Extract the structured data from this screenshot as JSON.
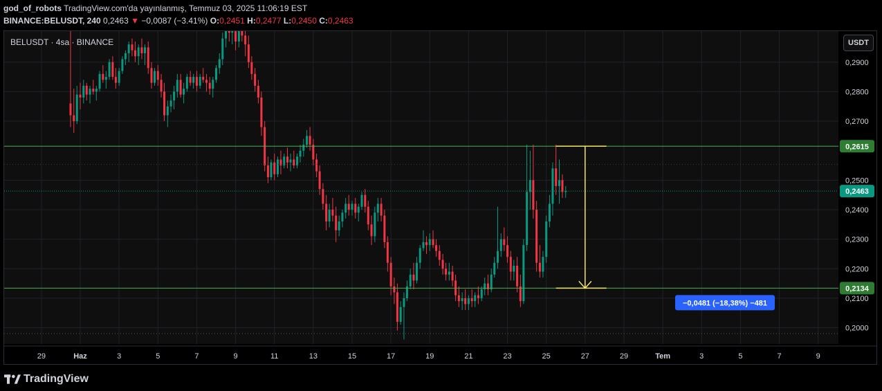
{
  "header": {
    "author": "god_of_robots",
    "published": "TradingView.com'da yayınlanmış, Temmuz 03, 2025 11:06:19 EST",
    "symbol": "BINANCE:BELUSDT, 240",
    "last": "0,2463",
    "change_arrow": "▼",
    "change": "−0,0087 (−3.41%)",
    "o_label": "O:",
    "o_value": "0,2451",
    "h_label": "H:",
    "h_value": "0,2477",
    "l_label": "L:",
    "l_value": "0,2450",
    "c_label": "C:",
    "c_value": "0,2463"
  },
  "legend": {
    "symbol_title": "BELUSDT · 4sa · BINANCE"
  },
  "currency_button": "USDT",
  "footer": {
    "brand": "TradingView"
  },
  "colors": {
    "up": "#089981",
    "down": "#f23645",
    "level_line": "#4caf50",
    "measure": "#f5e663",
    "measure_badge": "#2962ff"
  },
  "chart_data": {
    "type": "candlestick",
    "ylim": [
      0.1945,
      0.3005
    ],
    "price_ticks": [
      "0,2900",
      "0,2800",
      "0,2700",
      "0,2500",
      "0,2400",
      "0,2300",
      "0,2200",
      "0,2100",
      "0,2000"
    ],
    "price_tick_values": [
      0.29,
      0.28,
      0.27,
      0.25,
      0.24,
      0.23,
      0.22,
      0.21,
      0.2
    ],
    "date_ticks": [
      "29",
      "Haz",
      "3",
      "5",
      "7",
      "9",
      "11",
      "13",
      "15",
      "17",
      "19",
      "21",
      "23",
      "25",
      "27",
      "29",
      "Tem",
      "3",
      "5",
      "7",
      "9"
    ],
    "date_tick_days": [
      -2,
      0,
      2,
      4,
      6,
      8,
      10,
      12,
      14,
      16,
      18,
      20,
      22,
      24,
      26,
      28,
      30,
      32,
      34,
      36,
      38
    ],
    "levels": [
      {
        "value": 0.2615,
        "label": "0,2615"
      },
      {
        "value": 0.2134,
        "label": "0,2134"
      }
    ],
    "current_price": {
      "value": 0.2463,
      "label": "0,2463"
    },
    "measurement": {
      "from": 0.2615,
      "to": 0.2134,
      "label": "−0,0481 (−18,38%) −481"
    },
    "ohlc_fields": [
      "day",
      "open",
      "high",
      "low",
      "close"
    ],
    "ohlc": [
      [
        -0.5,
        0.276,
        0.305,
        0.268,
        0.272
      ],
      [
        -0.33,
        0.272,
        0.281,
        0.266,
        0.27
      ],
      [
        -0.17,
        0.27,
        0.282,
        0.269,
        0.279
      ],
      [
        0,
        0.279,
        0.283,
        0.274,
        0.278
      ],
      [
        0.17,
        0.278,
        0.284,
        0.276,
        0.282
      ],
      [
        0.33,
        0.282,
        0.283,
        0.277,
        0.279
      ],
      [
        0.5,
        0.279,
        0.282,
        0.276,
        0.281
      ],
      [
        0.67,
        0.281,
        0.284,
        0.279,
        0.28
      ],
      [
        0.83,
        0.28,
        0.282,
        0.277,
        0.281
      ],
      [
        1,
        0.281,
        0.287,
        0.28,
        0.286
      ],
      [
        1.17,
        0.286,
        0.289,
        0.283,
        0.284
      ],
      [
        1.33,
        0.284,
        0.287,
        0.281,
        0.285
      ],
      [
        1.5,
        0.285,
        0.291,
        0.284,
        0.29
      ],
      [
        1.67,
        0.29,
        0.292,
        0.284,
        0.285
      ],
      [
        1.83,
        0.285,
        0.288,
        0.281,
        0.283
      ],
      [
        2,
        0.283,
        0.288,
        0.282,
        0.287
      ],
      [
        2.17,
        0.287,
        0.292,
        0.286,
        0.291
      ],
      [
        2.33,
        0.291,
        0.294,
        0.289,
        0.293
      ],
      [
        2.5,
        0.293,
        0.297,
        0.29,
        0.296
      ],
      [
        2.67,
        0.296,
        0.298,
        0.292,
        0.294
      ],
      [
        2.83,
        0.294,
        0.297,
        0.29,
        0.292
      ],
      [
        3,
        0.292,
        0.296,
        0.289,
        0.295
      ],
      [
        3.17,
        0.295,
        0.298,
        0.291,
        0.293
      ],
      [
        3.33,
        0.293,
        0.296,
        0.289,
        0.295
      ],
      [
        3.5,
        0.295,
        0.297,
        0.286,
        0.288
      ],
      [
        3.67,
        0.288,
        0.29,
        0.281,
        0.283
      ],
      [
        3.83,
        0.283,
        0.288,
        0.282,
        0.287
      ],
      [
        4,
        0.287,
        0.289,
        0.282,
        0.284
      ],
      [
        4.17,
        0.284,
        0.286,
        0.278,
        0.28
      ],
      [
        4.33,
        0.28,
        0.283,
        0.27,
        0.272
      ],
      [
        4.5,
        0.272,
        0.277,
        0.268,
        0.275
      ],
      [
        4.67,
        0.275,
        0.279,
        0.273,
        0.277
      ],
      [
        4.83,
        0.277,
        0.282,
        0.274,
        0.28
      ],
      [
        5,
        0.28,
        0.286,
        0.278,
        0.284
      ],
      [
        5.17,
        0.284,
        0.286,
        0.278,
        0.279
      ],
      [
        5.33,
        0.279,
        0.283,
        0.276,
        0.281
      ],
      [
        5.5,
        0.281,
        0.286,
        0.28,
        0.285
      ],
      [
        5.67,
        0.285,
        0.287,
        0.282,
        0.283
      ],
      [
        5.83,
        0.283,
        0.286,
        0.281,
        0.285
      ],
      [
        6,
        0.285,
        0.287,
        0.28,
        0.282
      ],
      [
        6.17,
        0.282,
        0.286,
        0.281,
        0.285
      ],
      [
        6.33,
        0.285,
        0.288,
        0.283,
        0.284
      ],
      [
        6.5,
        0.284,
        0.286,
        0.28,
        0.283
      ],
      [
        6.67,
        0.283,
        0.285,
        0.279,
        0.281
      ],
      [
        6.83,
        0.281,
        0.285,
        0.278,
        0.284
      ],
      [
        7,
        0.284,
        0.289,
        0.283,
        0.288
      ],
      [
        7.17,
        0.288,
        0.293,
        0.286,
        0.291
      ],
      [
        7.33,
        0.291,
        0.3,
        0.289,
        0.298
      ],
      [
        7.5,
        0.298,
        0.305,
        0.295,
        0.302
      ],
      [
        7.67,
        0.302,
        0.305,
        0.297,
        0.3
      ],
      [
        7.83,
        0.3,
        0.305,
        0.296,
        0.303
      ],
      [
        8,
        0.303,
        0.305,
        0.294,
        0.297
      ],
      [
        8.17,
        0.297,
        0.303,
        0.295,
        0.301
      ],
      [
        8.33,
        0.301,
        0.305,
        0.297,
        0.299
      ],
      [
        8.5,
        0.299,
        0.305,
        0.292,
        0.296
      ],
      [
        8.67,
        0.296,
        0.299,
        0.288,
        0.29
      ],
      [
        8.83,
        0.29,
        0.292,
        0.284,
        0.286
      ],
      [
        9,
        0.286,
        0.288,
        0.28,
        0.282
      ],
      [
        9.17,
        0.282,
        0.284,
        0.276,
        0.278
      ],
      [
        9.33,
        0.278,
        0.28,
        0.265,
        0.268
      ],
      [
        9.5,
        0.268,
        0.27,
        0.253,
        0.255
      ],
      [
        9.67,
        0.255,
        0.258,
        0.249,
        0.251
      ],
      [
        9.83,
        0.251,
        0.257,
        0.25,
        0.256
      ],
      [
        10,
        0.256,
        0.259,
        0.25,
        0.252
      ],
      [
        10.17,
        0.252,
        0.258,
        0.251,
        0.257
      ],
      [
        10.33,
        0.257,
        0.26,
        0.252,
        0.255
      ],
      [
        10.5,
        0.255,
        0.259,
        0.254,
        0.258
      ],
      [
        10.67,
        0.258,
        0.261,
        0.254,
        0.256
      ],
      [
        10.83,
        0.256,
        0.259,
        0.253,
        0.257
      ],
      [
        11,
        0.257,
        0.26,
        0.254,
        0.255
      ],
      [
        11.17,
        0.255,
        0.259,
        0.254,
        0.258
      ],
      [
        11.33,
        0.258,
        0.262,
        0.256,
        0.26
      ],
      [
        11.5,
        0.26,
        0.264,
        0.258,
        0.262
      ],
      [
        11.67,
        0.262,
        0.267,
        0.261,
        0.265
      ],
      [
        11.83,
        0.265,
        0.268,
        0.26,
        0.262
      ],
      [
        12,
        0.262,
        0.264,
        0.255,
        0.257
      ],
      [
        12.17,
        0.257,
        0.259,
        0.251,
        0.253
      ],
      [
        12.33,
        0.253,
        0.255,
        0.245,
        0.247
      ],
      [
        12.5,
        0.247,
        0.249,
        0.24,
        0.242
      ],
      [
        12.67,
        0.242,
        0.245,
        0.233,
        0.236
      ],
      [
        12.83,
        0.236,
        0.242,
        0.234,
        0.24
      ],
      [
        13,
        0.24,
        0.244,
        0.236,
        0.238
      ],
      [
        13.17,
        0.238,
        0.241,
        0.229,
        0.233
      ],
      [
        13.33,
        0.233,
        0.238,
        0.231,
        0.236
      ],
      [
        13.5,
        0.236,
        0.24,
        0.234,
        0.239
      ],
      [
        13.67,
        0.239,
        0.244,
        0.237,
        0.242
      ],
      [
        13.83,
        0.242,
        0.245,
        0.238,
        0.24
      ],
      [
        14,
        0.24,
        0.243,
        0.238,
        0.242
      ],
      [
        14.17,
        0.242,
        0.244,
        0.237,
        0.239
      ],
      [
        14.33,
        0.239,
        0.242,
        0.236,
        0.241
      ],
      [
        14.5,
        0.241,
        0.246,
        0.24,
        0.245
      ],
      [
        14.67,
        0.245,
        0.247,
        0.239,
        0.241
      ],
      [
        14.83,
        0.241,
        0.243,
        0.233,
        0.235
      ],
      [
        15,
        0.235,
        0.238,
        0.228,
        0.231
      ],
      [
        15.17,
        0.231,
        0.241,
        0.229,
        0.239
      ],
      [
        15.33,
        0.239,
        0.244,
        0.236,
        0.242
      ],
      [
        15.5,
        0.242,
        0.244,
        0.236,
        0.238
      ],
      [
        15.67,
        0.238,
        0.24,
        0.227,
        0.229
      ],
      [
        15.83,
        0.229,
        0.231,
        0.219,
        0.222
      ],
      [
        16,
        0.222,
        0.224,
        0.211,
        0.214
      ],
      [
        16.17,
        0.214,
        0.217,
        0.208,
        0.212
      ],
      [
        16.33,
        0.212,
        0.215,
        0.199,
        0.202
      ],
      [
        16.5,
        0.202,
        0.209,
        0.201,
        0.207
      ],
      [
        16.67,
        0.207,
        0.212,
        0.196,
        0.21
      ],
      [
        16.83,
        0.21,
        0.216,
        0.209,
        0.214
      ],
      [
        17,
        0.214,
        0.22,
        0.213,
        0.218
      ],
      [
        17.17,
        0.218,
        0.222,
        0.213,
        0.216
      ],
      [
        17.33,
        0.216,
        0.224,
        0.215,
        0.222
      ],
      [
        17.5,
        0.222,
        0.228,
        0.22,
        0.227
      ],
      [
        17.67,
        0.227,
        0.233,
        0.226,
        0.229
      ],
      [
        17.83,
        0.229,
        0.231,
        0.225,
        0.228
      ],
      [
        18,
        0.228,
        0.232,
        0.226,
        0.23
      ],
      [
        18.17,
        0.23,
        0.233,
        0.227,
        0.228
      ],
      [
        18.33,
        0.228,
        0.23,
        0.224,
        0.226
      ],
      [
        18.5,
        0.226,
        0.228,
        0.221,
        0.223
      ],
      [
        18.67,
        0.223,
        0.225,
        0.218,
        0.22
      ],
      [
        18.83,
        0.22,
        0.222,
        0.216,
        0.218
      ],
      [
        19,
        0.218,
        0.222,
        0.216,
        0.219
      ],
      [
        19.17,
        0.219,
        0.221,
        0.214,
        0.216
      ],
      [
        19.33,
        0.216,
        0.218,
        0.209,
        0.211
      ],
      [
        19.5,
        0.211,
        0.214,
        0.207,
        0.209
      ],
      [
        19.67,
        0.209,
        0.212,
        0.206,
        0.21
      ],
      [
        19.83,
        0.21,
        0.213,
        0.206,
        0.208
      ],
      [
        20,
        0.208,
        0.211,
        0.206,
        0.21
      ],
      [
        20.17,
        0.21,
        0.213,
        0.207,
        0.209
      ],
      [
        20.33,
        0.209,
        0.212,
        0.207,
        0.211
      ],
      [
        20.5,
        0.211,
        0.214,
        0.208,
        0.21
      ],
      [
        20.67,
        0.21,
        0.214,
        0.209,
        0.213
      ],
      [
        20.83,
        0.213,
        0.217,
        0.211,
        0.215
      ],
      [
        21,
        0.215,
        0.218,
        0.211,
        0.213
      ],
      [
        21.17,
        0.213,
        0.22,
        0.212,
        0.218
      ],
      [
        21.33,
        0.218,
        0.224,
        0.217,
        0.222
      ],
      [
        21.5,
        0.222,
        0.241,
        0.22,
        0.226
      ],
      [
        21.67,
        0.226,
        0.232,
        0.224,
        0.23
      ],
      [
        21.83,
        0.23,
        0.234,
        0.226,
        0.228
      ],
      [
        22,
        0.228,
        0.231,
        0.222,
        0.224
      ],
      [
        22.17,
        0.224,
        0.226,
        0.216,
        0.219
      ],
      [
        22.33,
        0.219,
        0.223,
        0.216,
        0.221
      ],
      [
        22.5,
        0.221,
        0.224,
        0.212,
        0.214
      ],
      [
        22.67,
        0.214,
        0.218,
        0.207,
        0.209
      ],
      [
        22.83,
        0.209,
        0.23,
        0.208,
        0.228
      ],
      [
        23,
        0.228,
        0.262,
        0.226,
        0.246
      ],
      [
        23.17,
        0.246,
        0.26,
        0.24,
        0.25
      ],
      [
        23.33,
        0.25,
        0.262,
        0.237,
        0.24
      ],
      [
        23.5,
        0.24,
        0.243,
        0.219,
        0.222
      ],
      [
        23.67,
        0.222,
        0.228,
        0.217,
        0.219
      ],
      [
        23.83,
        0.219,
        0.226,
        0.217,
        0.224
      ],
      [
        24,
        0.224,
        0.238,
        0.222,
        0.236
      ],
      [
        24.17,
        0.236,
        0.245,
        0.234,
        0.242
      ],
      [
        24.33,
        0.242,
        0.256,
        0.238,
        0.254
      ],
      [
        24.5,
        0.254,
        0.262,
        0.245,
        0.248
      ],
      [
        24.67,
        0.248,
        0.257,
        0.242,
        0.25
      ],
      [
        24.83,
        0.25,
        0.252,
        0.244,
        0.246
      ],
      [
        25,
        0.246,
        0.248,
        0.244,
        0.2463
      ]
    ]
  }
}
